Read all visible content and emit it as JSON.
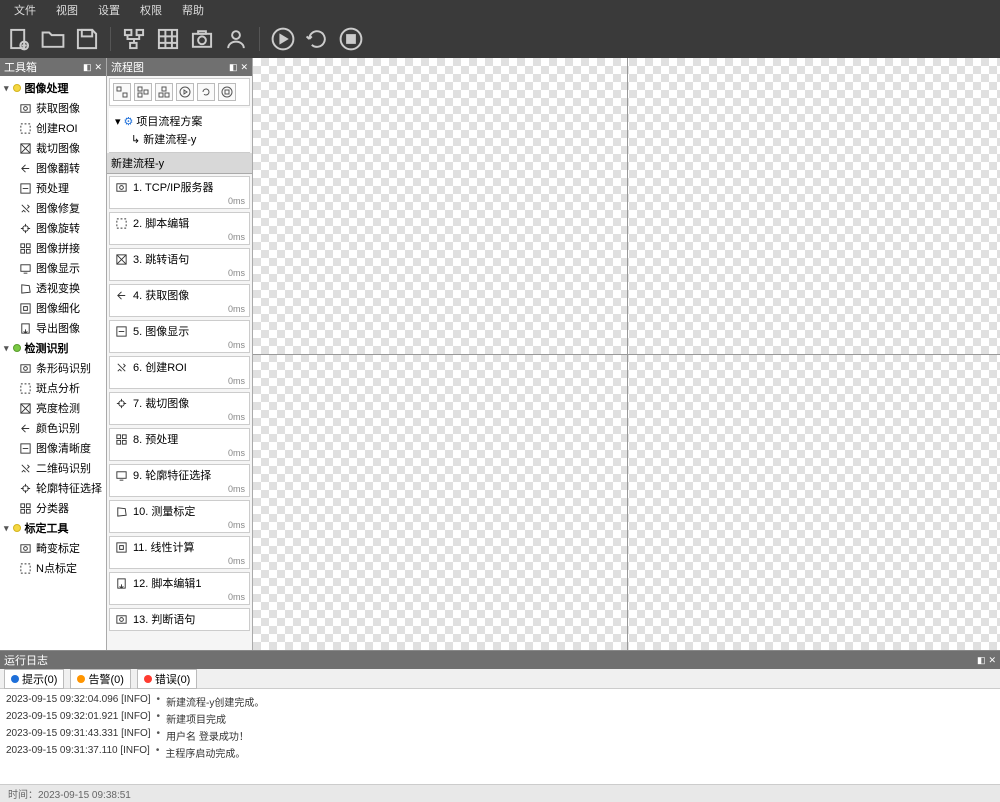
{
  "menu": [
    "文件",
    "视图",
    "设置",
    "权限",
    "帮助"
  ],
  "toolbox": {
    "title": "工具箱",
    "cats": [
      {
        "label": "图像处理",
        "color": "y",
        "items": [
          "获取图像",
          "创建ROI",
          "裁切图像",
          "图像翻转",
          "预处理",
          "图像修复",
          "图像旋转",
          "图像拼接",
          "图像显示",
          "透视变换",
          "图像细化",
          "导出图像"
        ]
      },
      {
        "label": "检测识别",
        "color": "g",
        "items": [
          "条形码识别",
          "斑点分析",
          "亮度检测",
          "颜色识别",
          "图像清晰度",
          "二维码识别",
          "轮廓特征选择",
          "分类器"
        ]
      },
      {
        "label": "标定工具",
        "color": "y",
        "items": [
          "畸变标定",
          "N点标定"
        ]
      }
    ]
  },
  "flowchart": {
    "title": "流程图",
    "project": "项目流程方案",
    "sub": "新建流程-y",
    "tab": "新建流程-y",
    "steps": [
      {
        "n": "1",
        "label": "TCP/IP服务器",
        "t": "0ms"
      },
      {
        "n": "2",
        "label": "脚本编辑",
        "t": "0ms"
      },
      {
        "n": "3",
        "label": "跳转语句",
        "t": "0ms"
      },
      {
        "n": "4",
        "label": "获取图像",
        "t": "0ms"
      },
      {
        "n": "5",
        "label": "图像显示",
        "t": "0ms"
      },
      {
        "n": "6",
        "label": "创建ROI",
        "t": "0ms"
      },
      {
        "n": "7",
        "label": "裁切图像",
        "t": "0ms"
      },
      {
        "n": "8",
        "label": "预处理",
        "t": "0ms"
      },
      {
        "n": "9",
        "label": "轮廓特征选择",
        "t": "0ms"
      },
      {
        "n": "10",
        "label": "测量标定",
        "t": "0ms"
      },
      {
        "n": "11",
        "label": "线性计算",
        "t": "0ms"
      },
      {
        "n": "12",
        "label": "脚本编辑1",
        "t": "0ms"
      },
      {
        "n": "13",
        "label": "判断语句",
        "t": ""
      }
    ]
  },
  "log": {
    "title": "运行日志",
    "tabs": [
      {
        "dot": "blue",
        "label": "提示(0)"
      },
      {
        "dot": "or",
        "label": "告警(0)"
      },
      {
        "dot": "red",
        "label": "错误(0)"
      }
    ],
    "lines": [
      {
        "ts": "2023-09-15 09:32:04.096 [INFO]",
        "msg": "新建流程-y创建完成。"
      },
      {
        "ts": "2023-09-15 09:32:01.921 [INFO]",
        "msg": "新建项目完成"
      },
      {
        "ts": "2023-09-15 09:31:43.331 [INFO]",
        "msg": "用户名 登录成功！"
      },
      {
        "ts": "2023-09-15 09:31:37.110 [INFO]",
        "msg": "主程序启动完成。"
      }
    ]
  },
  "status": "时间：2023-09-15  09:38:51"
}
